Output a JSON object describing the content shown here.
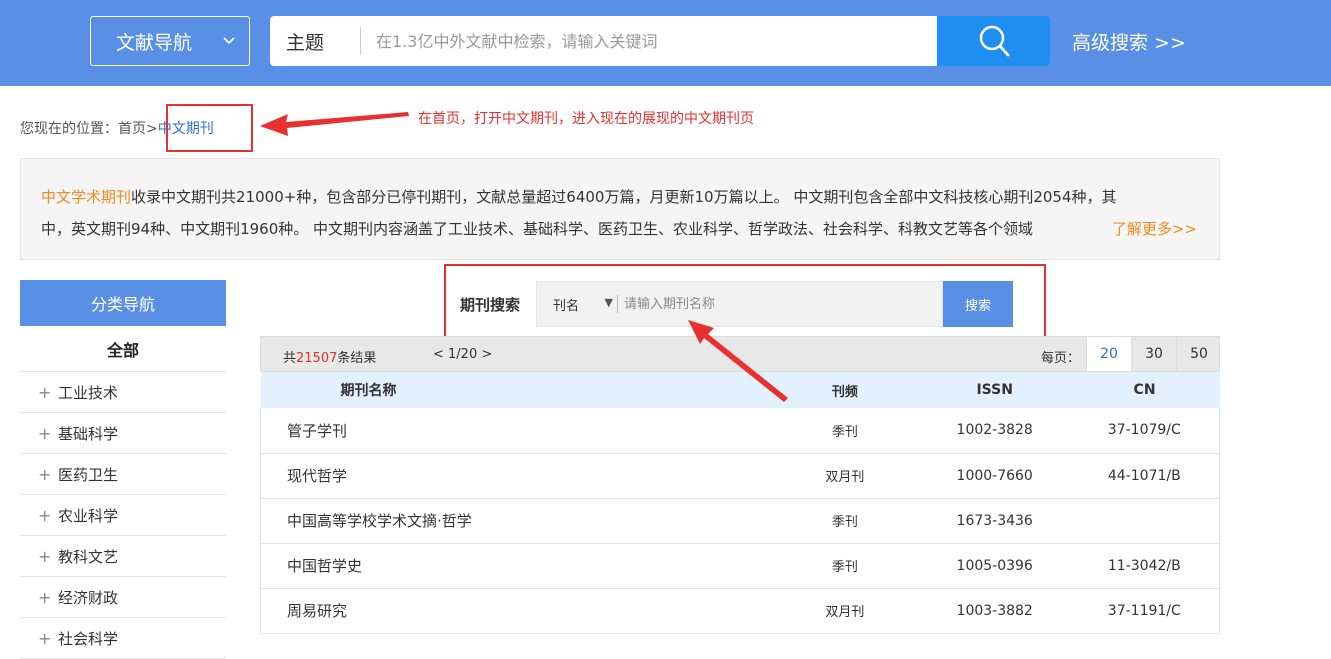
{
  "header": {
    "nav_dropdown_label": "文献导航",
    "search_type": "主题",
    "search_placeholder": "在1.3亿中外文献中检索，请输入关键词",
    "advanced_search": "高级搜索 >>"
  },
  "breadcrumb": {
    "prefix": "您现在的位置：",
    "home": "首页",
    "separator": ">",
    "current": "中文期刊"
  },
  "annotation": {
    "text": "在首页，打开中文期刊，进入现在的展现的中文期刊页",
    "color": "#e8302e"
  },
  "intro": {
    "highlight": "中文学术期刊",
    "line1_rest": "收录中文期刊共21000+种，包含部分已停刊期刊，文献总量超过6400万篇，月更新10万篇以上。 中文期刊包含全部中文科技核心期刊2054种，其",
    "line2": "中，英文期刊94种、中文期刊1960种。 中文期刊内容涵盖了工业技术、基础科学、医药卫生、农业科学、哲学政法、社会科学、科教文艺等各个领域",
    "more": "了解更多>>"
  },
  "sidebar": {
    "title": "分类导航",
    "all": "全部",
    "categories": [
      {
        "label": "工业技术"
      },
      {
        "label": "基础科学"
      },
      {
        "label": "医药卫生"
      },
      {
        "label": "农业科学"
      },
      {
        "label": "教科文艺"
      },
      {
        "label": "经济财政"
      },
      {
        "label": "社会科学"
      }
    ],
    "plus": "+"
  },
  "journal_search": {
    "label": "期刊搜索",
    "field_select": "刊名",
    "placeholder": "请输入期刊名称",
    "button": "搜索"
  },
  "results": {
    "count_prefix": "共",
    "count": "21507",
    "count_suffix": "条结果",
    "pager": "< 1/20 >",
    "per_page_label": "每页：",
    "page_sizes": [
      "20",
      "30",
      "50"
    ],
    "active_page_size": "20",
    "columns": [
      "期刊名称",
      "刊频",
      "ISSN",
      "CN"
    ],
    "rows": [
      {
        "name": "管子学刊",
        "freq": "季刊",
        "issn": "1002-3828",
        "cn": "37-1079/C"
      },
      {
        "name": "现代哲学",
        "freq": "双月刊",
        "issn": "1000-7660",
        "cn": "44-1071/B"
      },
      {
        "name": "中国高等学校学术文摘·哲学",
        "freq": "季刊",
        "issn": "1673-3436",
        "cn": ""
      },
      {
        "name": "中国哲学史",
        "freq": "季刊",
        "issn": "1005-0396",
        "cn": "11-3042/B"
      },
      {
        "name": "周易研究",
        "freq": "双月刊",
        "issn": "1003-3882",
        "cn": "37-1191/C"
      }
    ]
  },
  "colors": {
    "brand_blue": "#5a8fe6",
    "search_button": "#1f8ef1",
    "accent_orange": "#f08b20",
    "annotation_red": "#e8302e"
  }
}
